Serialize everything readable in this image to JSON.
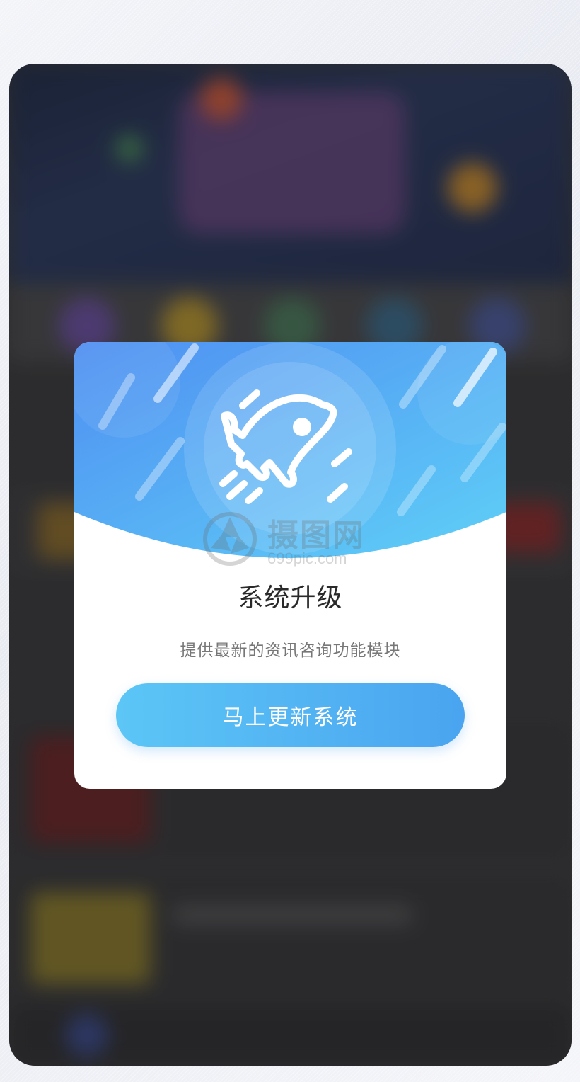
{
  "dialog": {
    "title": "系统升级",
    "subtitle": "提供最新的资讯咨询功能模块",
    "button_label": "马上更新系统",
    "icon": "rocket-icon"
  },
  "watermark": {
    "name": "摄图网",
    "url": "699pic.com"
  },
  "colors": {
    "header_gradient_start": "#4f8ff2",
    "header_gradient_end": "#5fd0f7",
    "button_gradient_start": "#5cc6f6",
    "button_gradient_end": "#4aa4f0",
    "backdrop": "#3a3a3c"
  }
}
